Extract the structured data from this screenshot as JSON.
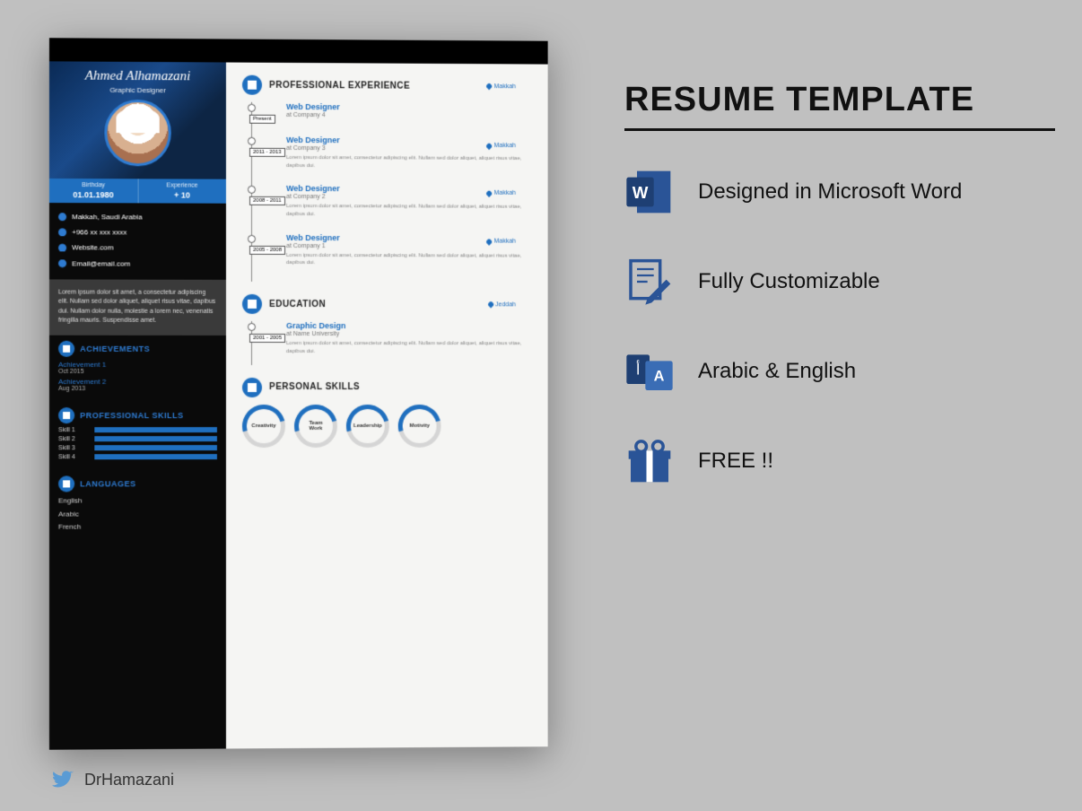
{
  "promo": {
    "title": "RESUME TEMPLATE",
    "features": [
      {
        "label": "Designed in Microsoft Word"
      },
      {
        "label": "Fully Customizable"
      },
      {
        "label": "Arabic & English"
      },
      {
        "label": "FREE !!"
      }
    ]
  },
  "twitter": {
    "handle": "DrHamazani"
  },
  "person": {
    "name": "Ahmed Alhamazani",
    "title": "Graphic Designer"
  },
  "info": {
    "birthday_label": "Birthday",
    "birthday": "01.01.1980",
    "experience_label": "Experience",
    "experience": "+ 10"
  },
  "contact": {
    "location": "Makkah, Saudi Arabia",
    "phone": "+966 xx xxx xxxx",
    "website": "Website.com",
    "email": "Email@email.com"
  },
  "about": "Lorem ipsum dolor sit amet, a consectetur adipiscing elit. Nullam sed dolor aliquet, aliquet risus vitae, dapibus dui. Nullam dolor nulla, molestie a lorem nec, venenatis fringilla mauris. Suspendisse amet.",
  "sections": {
    "achievements": "ACHIEVEMENTS",
    "prof_skills": "PROFESSIONAL SKILLS",
    "languages": "LANGUAGES",
    "experience": "PROFESSIONAL EXPERIENCE",
    "education": "EDUCATION",
    "personal_skills": "PERSONAL SKILLS"
  },
  "achievements": [
    {
      "title": "Achievement 1",
      "date": "Oct 2015"
    },
    {
      "title": "Achievement 2",
      "date": "Aug 2013"
    }
  ],
  "skills": [
    {
      "name": "Skill 1"
    },
    {
      "name": "Skill 2"
    },
    {
      "name": "Skill 3"
    },
    {
      "name": "Skill 4"
    }
  ],
  "languages": [
    "English",
    "Arabic",
    "French"
  ],
  "experience": [
    {
      "period": "Present",
      "title": "Web Designer",
      "company": "at Company 4",
      "location": "Makkah",
      "desc": ""
    },
    {
      "period": "2011 - 2013",
      "title": "Web Designer",
      "company": "at Company 3",
      "location": "Makkah",
      "desc": "Lorem ipsum dolor sit amet, consectetur adipiscing elit. Nullam sed dolor aliquet, aliquet risus vitae, dapibus dui."
    },
    {
      "period": "2008 - 2011",
      "title": "Web Designer",
      "company": "at Company 2",
      "location": "Makkah",
      "desc": "Lorem ipsum dolor sit amet, consectetur adipiscing elit. Nullam sed dolor aliquet, aliquet risus vitae, dapibus dui."
    },
    {
      "period": "2005 - 2008",
      "title": "Web Designer",
      "company": "at Company 1",
      "location": "Makkah",
      "desc": "Lorem ipsum dolor sit amet, consectetur adipiscing elit. Nullam sed dolor aliquet, aliquet risus vitae, dapibus dui."
    }
  ],
  "education": [
    {
      "period": "2001 - 2005",
      "title": "Graphic Design",
      "company": "at Name University",
      "location": "Jeddah",
      "desc": "Lorem ipsum dolor sit amet, consectetur adipiscing elit. Nullam sed dolor aliquet, aliquet risus vitae, dapibus dui."
    }
  ],
  "personal_skills": [
    "Creativity",
    "Team\nWork",
    "Leadership",
    "Motivity"
  ]
}
